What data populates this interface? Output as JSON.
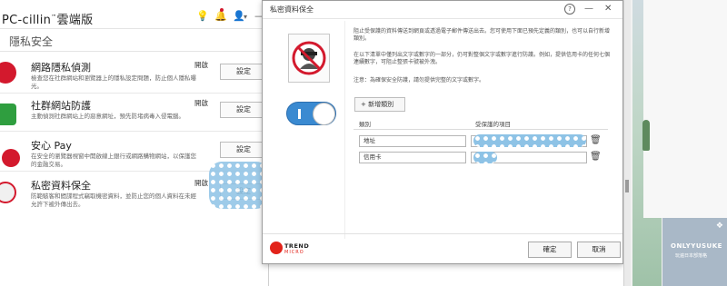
{
  "main": {
    "app_title": "PC-cillin",
    "app_title_tm": "™",
    "app_title_suffix": "雲端版",
    "controls": {
      "lightbulb": "💡",
      "bell": "🔔",
      "user": "👤",
      "user_caret": "▾",
      "minimize": "—"
    },
    "section_title": "隱私安全",
    "features": [
      {
        "name": "網路隱私偵測",
        "status": "開啟",
        "button": "設定",
        "description": "檢查您在社群網站和瀏覽器上的隱私設定問題，防止個人隱私曝光。",
        "icon": "privacy-scanner-icon",
        "icon_color": "#d3192d"
      },
      {
        "name": "社群網站防護",
        "status": "開啟",
        "button": "設定",
        "description": "主動偵測社群網站上的惡意網址，預先防堵病毒入侵電腦。",
        "icon": "social-network-icon",
        "icon_color": "#2f9e3f"
      },
      {
        "name": "安心 Pay",
        "status": "",
        "button": "設定",
        "description": "在安全的瀏覽器視窗中開啟線上銀行或網路購物網站，以保護您的金融交易。",
        "icon": "pay-guard-icon",
        "icon_color": "#d3192d"
      },
      {
        "name": "私密資料保全",
        "status": "開啟",
        "button": "設定",
        "description": "防範駭客和間諜程式竊取機密資料，並防止您的個人資料在未經允許下被外傳出去。",
        "icon": "data-theft-icon",
        "icon_color": "#d3192d"
      }
    ]
  },
  "dialog": {
    "title": "私密資料保全",
    "controls": {
      "help": "?",
      "minimize": "—",
      "close": "✕"
    },
    "paragraphs": [
      "阻止受保護的資料傳送到網頁或透過電子郵件傳送出去。您可使用下面已預先定義的類別，也可以自行新增類別。",
      "在以下清單中僅列出文字或數字的一部分，仍可對整個文字或數字進行防護。例如，提供信用卡的任何七個連續數字，可阻止整張卡號被外洩。",
      "注意：為確保安全防護，請勿提供完整的文字或數字。"
    ],
    "add_button": "+ 新增類別",
    "table": {
      "columns": [
        "類別",
        "受保護的項目"
      ],
      "rows": [
        {
          "category": "地址",
          "item": ""
        },
        {
          "category": "信用卡",
          "item": ""
        }
      ]
    },
    "brand_line1": "TREND",
    "brand_line2": "MICRO",
    "ok_button": "確定",
    "cancel_button": "取消",
    "toggle_state": "on"
  },
  "watermark": {
    "line1": "ONLYYUSUKE",
    "line2": "玩遍日本部落格",
    "corner": "❖"
  },
  "colors": {
    "accent": "#3a8ad1",
    "brand_red": "#e2231a",
    "dots_blue": "#8ec3e6"
  }
}
